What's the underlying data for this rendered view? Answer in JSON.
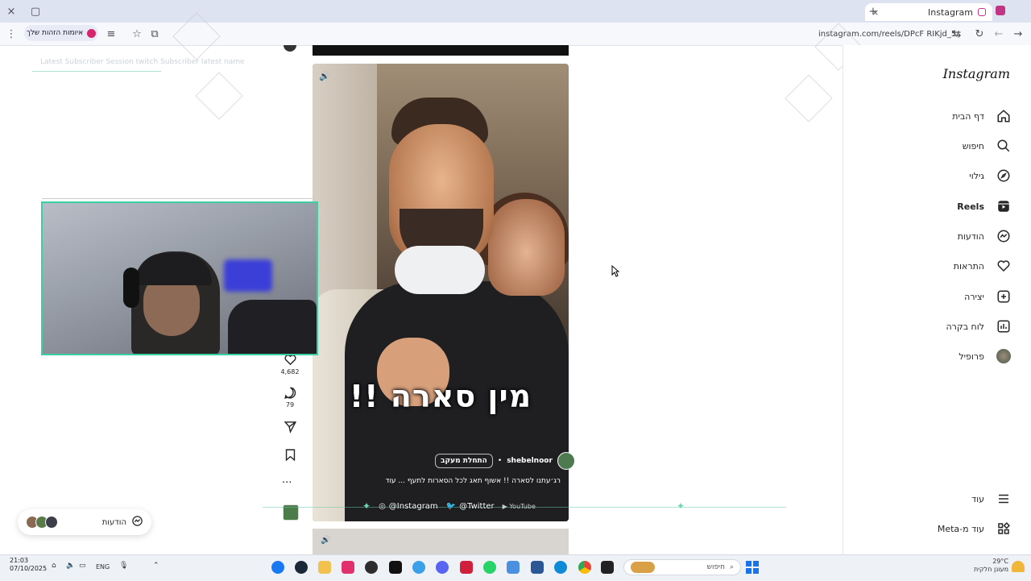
{
  "browser": {
    "tab_title": "Instagram",
    "url": "instagram.com/reels/DPcF RIKjd_5/",
    "identity_chip": "איומות הזהות שלך",
    "tab_close": "×",
    "window_close": "×",
    "new_tab": "+"
  },
  "nav": {
    "logo": "Instagram",
    "items": [
      {
        "label": "דף הבית",
        "icon": "home-icon"
      },
      {
        "label": "חיפוש",
        "icon": "search-icon"
      },
      {
        "label": "גילוי",
        "icon": "compass-icon"
      },
      {
        "label": "Reels",
        "icon": "reels-icon"
      },
      {
        "label": "הודעות",
        "icon": "messenger-icon"
      },
      {
        "label": "התראות",
        "icon": "heart-icon"
      },
      {
        "label": "יצירה",
        "icon": "plus-square-icon"
      },
      {
        "label": "לוח בקרה",
        "icon": "dashboard-icon"
      },
      {
        "label": "פרופיל",
        "icon": "profile-avatar-icon"
      }
    ],
    "more": "עוד",
    "also_from_meta": "עוד מ-Meta"
  },
  "reel": {
    "overlay_text": "מין סארה !!",
    "author": "shebelnoor",
    "follow": "התחלת מעקב",
    "caption": "רג׳עתנו לסארה !! אשוף תאג לכל הסארות לתעף ... עוד",
    "likes": "4,682",
    "comments": "79",
    "more": "···"
  },
  "stream_overlay": {
    "instagram_handle": "@Instagram",
    "twitter_handle": "@Twitter",
    "youtube_handle": "YouTube",
    "subs_text": "Latest Subscriber Session twitch Subscriber latest name"
  },
  "messages_pill": {
    "label": "הודעות"
  },
  "taskbar": {
    "time": "21:03",
    "date": "07/10/2025",
    "lang": "ENG",
    "search_placeholder": "חיפוש",
    "weather_temp": "29°C",
    "weather_desc": "מעונן חלקית"
  }
}
